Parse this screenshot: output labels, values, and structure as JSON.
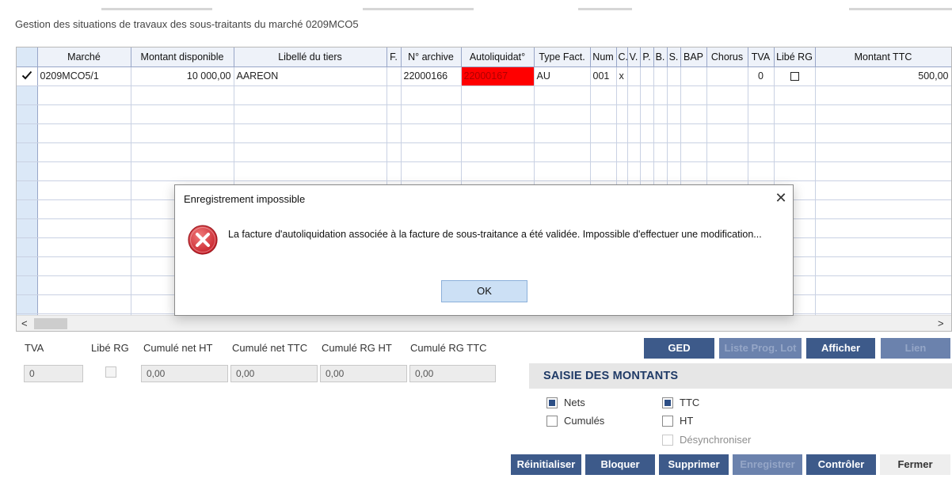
{
  "window": {
    "title": "Gestion des situations de travaux des sous-traitants du marché 0209MCO5"
  },
  "grid": {
    "columns": [
      "Marché",
      "Montant disponible",
      "Libellé du tiers",
      "F.",
      "N° archive",
      "Autoliquidat°",
      "Type Fact.",
      "Num",
      "C.",
      "V.",
      "P.",
      "B.",
      "S.",
      "BAP",
      "Chorus",
      "TVA",
      "Libé RG",
      "Montant TTC"
    ],
    "row1": {
      "marker_icon": "checkmark-icon",
      "marche": "0209MCO5/1",
      "montant_disponible": "10 000,00",
      "libelle_tiers": "AAREON",
      "f": "",
      "num_archive": "22000166",
      "autoliquidation": "22000167",
      "type_fact": "AU",
      "num": "001",
      "c": "x",
      "v": "",
      "p": "",
      "b": "",
      "s": "",
      "bap": "",
      "chorus": "",
      "tva": "0",
      "libe_rg": "",
      "montant_ttc": "500,00"
    },
    "autoliquidation_highlight_color": "#ff0000"
  },
  "scrollbar": {
    "left_arrow": "<",
    "right_arrow": ">"
  },
  "summary": {
    "tva_label": "TVA",
    "tva_value": "0",
    "libe_rg_label": "Libé RG",
    "cumule_net_ht_label": "Cumulé net HT",
    "cumule_net_ht_value": "0,00",
    "cumule_net_ttc_label": "Cumulé net TTC",
    "cumule_net_ttc_value": "0,00",
    "cumule_rg_ht_label": "Cumulé RG HT",
    "cumule_rg_ht_value": "0,00",
    "cumule_rg_ttc_label": "Cumulé RG TTC",
    "cumule_rg_ttc_value": "0,00"
  },
  "top_buttons": {
    "ged": "GED",
    "liste_prog_lot": "Liste Prog. Lot",
    "afficher": "Afficher",
    "lien": "Lien"
  },
  "saisie": {
    "title": "SAISIE DES MONTANTS",
    "nets": "Nets",
    "nets_checked": true,
    "cumules": "Cumulés",
    "cumules_checked": false,
    "ttc": "TTC",
    "ttc_checked": true,
    "ht": "HT",
    "ht_checked": false,
    "desynchroniser": "Désynchroniser",
    "desynchroniser_checked": false
  },
  "bottom_buttons": {
    "reinitialiser": "Réinitialiser",
    "bloquer": "Bloquer",
    "supprimer": "Supprimer",
    "enregistrer": "Enregistrer",
    "controler": "Contrôler",
    "fermer": "Fermer"
  },
  "dialog": {
    "title": "Enregistrement impossible",
    "close": "✕",
    "icon": "error-icon",
    "message": "La facture d'autoliquidation associée à la facture de sous-traitance a été validée. Impossible d'effectuer une modification...",
    "ok": "OK"
  },
  "colors": {
    "accent_button": "#3d5a8a",
    "disabled_button": "#6b82ad",
    "error_red": "#d9363e",
    "ok_button": "#cce0f5"
  }
}
